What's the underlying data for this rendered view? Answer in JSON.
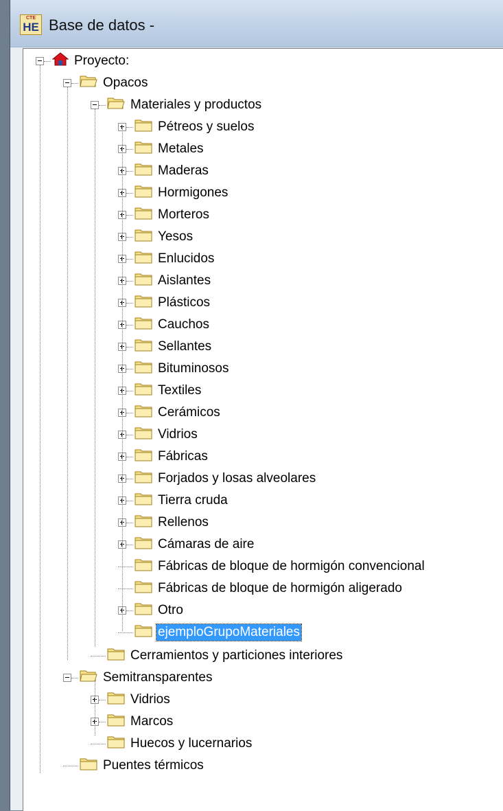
{
  "window": {
    "title": "Base de datos -",
    "app_icon_top": "CTE",
    "app_icon_bottom": "HE"
  },
  "tree": {
    "root": "Proyecto:",
    "opacos": "Opacos",
    "materiales": "Materiales y productos",
    "material_items": [
      "Pétreos y suelos",
      "Metales",
      "Maderas",
      "Hormigones",
      "Morteros",
      "Yesos",
      "Enlucidos",
      "Aislantes",
      "Plásticos",
      "Cauchos",
      "Sellantes",
      "Bituminosos",
      "Textiles",
      "Cerámicos",
      "Vidrios",
      "Fábricas",
      "Forjados y losas alveolares",
      "Tierra cruda",
      "Rellenos",
      "Cámaras de aire",
      "Fábricas de bloque de hormigón convencional",
      "Fábricas de bloque de hormigón aligerado",
      "Otro",
      "ejemploGrupoMateriales"
    ],
    "cerramientos": "Cerramientos y particiones interiores",
    "semitransparentes": "Semitransparentes",
    "semi_items": [
      "Vidrios",
      "Marcos",
      "Huecos y lucernarios"
    ],
    "puentes": "Puentes térmicos",
    "selected_item": "ejemploGrupoMateriales"
  },
  "colors": {
    "folder": "#f7e08a",
    "selection": "#3399ff"
  }
}
